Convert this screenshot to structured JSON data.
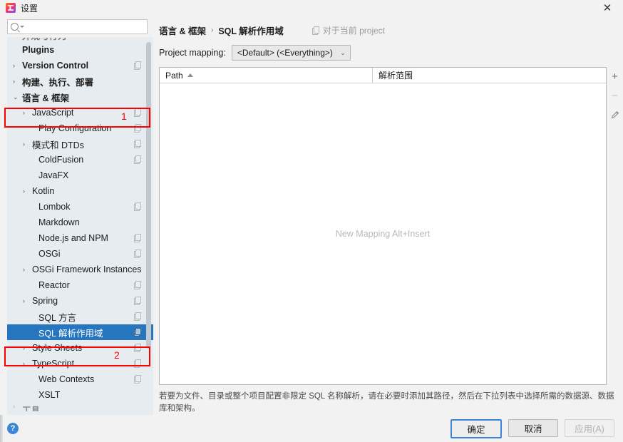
{
  "window": {
    "title": "设置",
    "app_icon": "intellij-idea-icon",
    "close_label": "✕"
  },
  "search": {
    "value": "",
    "placeholder": "",
    "icon": "search-icon",
    "caret_icon": "chevron-down-icon"
  },
  "sidebar": {
    "scrollbar": "vertical-scrollbar",
    "items": [
      {
        "label": "外观与行为",
        "level": 0,
        "arrow": "",
        "bold": true,
        "clipped": "top",
        "copy": false,
        "selected": false
      },
      {
        "label": "Plugins",
        "level": 0,
        "arrow": "",
        "bold": true,
        "copy": false,
        "selected": false
      },
      {
        "label": "Version Control",
        "level": 0,
        "arrow": "›",
        "bold": true,
        "copy": true,
        "selected": false
      },
      {
        "label": "构建、执行、部署",
        "level": 0,
        "arrow": "›",
        "bold": true,
        "copy": false,
        "selected": false,
        "clipped": "half"
      },
      {
        "label": "语言 & 框架",
        "level": 0,
        "arrow": "⌄",
        "bold": true,
        "copy": false,
        "selected": false,
        "annotated": 1
      },
      {
        "label": "JavaScript",
        "level": 1,
        "arrow": "›",
        "bold": false,
        "copy": true,
        "selected": false
      },
      {
        "label": "Play Configuration",
        "level": 2,
        "arrow": "",
        "bold": false,
        "copy": true,
        "selected": false
      },
      {
        "label": "模式和 DTDs",
        "level": 1,
        "arrow": "›",
        "bold": false,
        "copy": true,
        "selected": false
      },
      {
        "label": "ColdFusion",
        "level": 2,
        "arrow": "",
        "bold": false,
        "copy": true,
        "selected": false
      },
      {
        "label": "JavaFX",
        "level": 2,
        "arrow": "",
        "bold": false,
        "copy": false,
        "selected": false
      },
      {
        "label": "Kotlin",
        "level": 1,
        "arrow": "›",
        "bold": false,
        "copy": false,
        "selected": false
      },
      {
        "label": "Lombok",
        "level": 2,
        "arrow": "",
        "bold": false,
        "copy": true,
        "selected": false
      },
      {
        "label": "Markdown",
        "level": 2,
        "arrow": "",
        "bold": false,
        "copy": false,
        "selected": false
      },
      {
        "label": "Node.js and NPM",
        "level": 2,
        "arrow": "",
        "bold": false,
        "copy": true,
        "selected": false
      },
      {
        "label": "OSGi",
        "level": 2,
        "arrow": "",
        "bold": false,
        "copy": true,
        "selected": false
      },
      {
        "label": "OSGi Framework Instances",
        "level": 1,
        "arrow": "›",
        "bold": false,
        "copy": false,
        "selected": false
      },
      {
        "label": "Reactor",
        "level": 2,
        "arrow": "",
        "bold": false,
        "copy": true,
        "selected": false
      },
      {
        "label": "Spring",
        "level": 1,
        "arrow": "›",
        "bold": false,
        "copy": true,
        "selected": false
      },
      {
        "label": "SQL 方言",
        "level": 2,
        "arrow": "",
        "bold": false,
        "copy": true,
        "selected": false
      },
      {
        "label": "SQL 解析作用域",
        "level": 2,
        "arrow": "",
        "bold": false,
        "copy": true,
        "selected": true,
        "annotated": 2
      },
      {
        "label": "Style Sheets",
        "level": 1,
        "arrow": "›",
        "bold": false,
        "copy": true,
        "selected": false
      },
      {
        "label": "TypeScript",
        "level": 1,
        "arrow": "›",
        "bold": false,
        "copy": true,
        "selected": false
      },
      {
        "label": "Web Contexts",
        "level": 2,
        "arrow": "",
        "bold": false,
        "copy": true,
        "selected": false
      },
      {
        "label": "XSLT",
        "level": 2,
        "arrow": "",
        "bold": false,
        "copy": false,
        "selected": false
      },
      {
        "label": "工具",
        "level": 0,
        "arrow": "›",
        "bold": true,
        "copy": false,
        "selected": false,
        "clipped": "bottom"
      }
    ]
  },
  "annotations": [
    {
      "number": "1",
      "color": "#ff0000",
      "target": "语言 & 框架"
    },
    {
      "number": "2",
      "color": "#ff0000",
      "target": "SQL 解析作用域"
    }
  ],
  "breadcrumb": {
    "parent": "语言 & 框架",
    "separator": "›",
    "current": "SQL 解析作用域",
    "scope_note": "对于当前 project",
    "scope_icon": "copy-scope-icon"
  },
  "mapping": {
    "label": "Project mapping:",
    "value": "<Default> (<Everything>)",
    "chevron": "⌄"
  },
  "table": {
    "columns": [
      {
        "key": "path",
        "label": "Path",
        "sort": "asc",
        "sort_icon": "sort-ascending-icon"
      },
      {
        "key": "scope",
        "label": "解析范围",
        "sort": ""
      }
    ],
    "rows": [],
    "empty_text": "New Mapping Alt+Insert"
  },
  "toolbar": {
    "add_label": "+",
    "add_icon": "plus-icon",
    "remove_label": "−",
    "remove_icon": "minus-icon",
    "edit_icon": "pencil-icon",
    "remove_disabled": true
  },
  "hint": "若要为文件、目录或整个项目配置非限定 SQL 名称解析，请在必要时添加其路径，然后在下拉列表中选择所需的数据源、数据库和架构。",
  "footer": {
    "help_icon": "help-icon",
    "help_label": "?",
    "ok_label": "确定",
    "cancel_label": "取消",
    "apply_label": "应用(A)",
    "apply_disabled": true
  },
  "colors": {
    "selection": "#2675bf",
    "annotation": "#ff0000",
    "accent": "#3b87d6",
    "tree_bg": "#e7ecf0",
    "dialog_bg": "#f2f2f2"
  }
}
